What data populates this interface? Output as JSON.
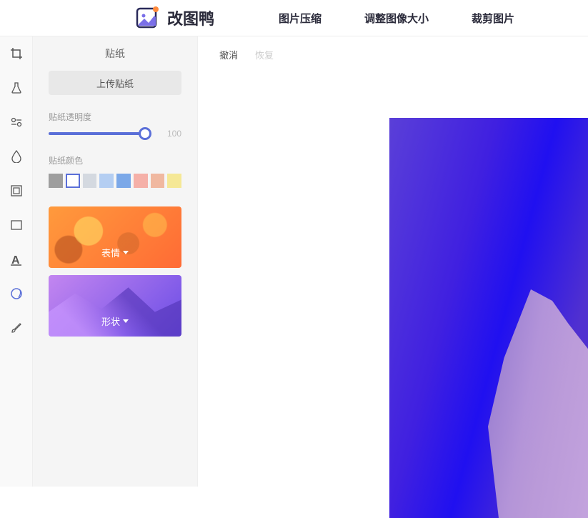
{
  "header": {
    "logo_text": "改图鸭",
    "nav": [
      "图片压缩",
      "调整图像大小",
      "裁剪图片"
    ]
  },
  "panel": {
    "title": "贴纸",
    "upload_label": "上传贴纸",
    "opacity_label": "贴纸透明度",
    "opacity_value": "100",
    "color_label": "贴纸颜色",
    "swatches": [
      "#9e9e9e",
      "#ffffff",
      "#d4d9e0",
      "#b4cef2",
      "#7ba8e8",
      "#f5b0a8",
      "#f0b8a0",
      "#f5e896"
    ],
    "categories": [
      {
        "label": "表情"
      },
      {
        "label": "形状"
      }
    ]
  },
  "canvas": {
    "undo": "撤消",
    "redo": "恢复"
  }
}
